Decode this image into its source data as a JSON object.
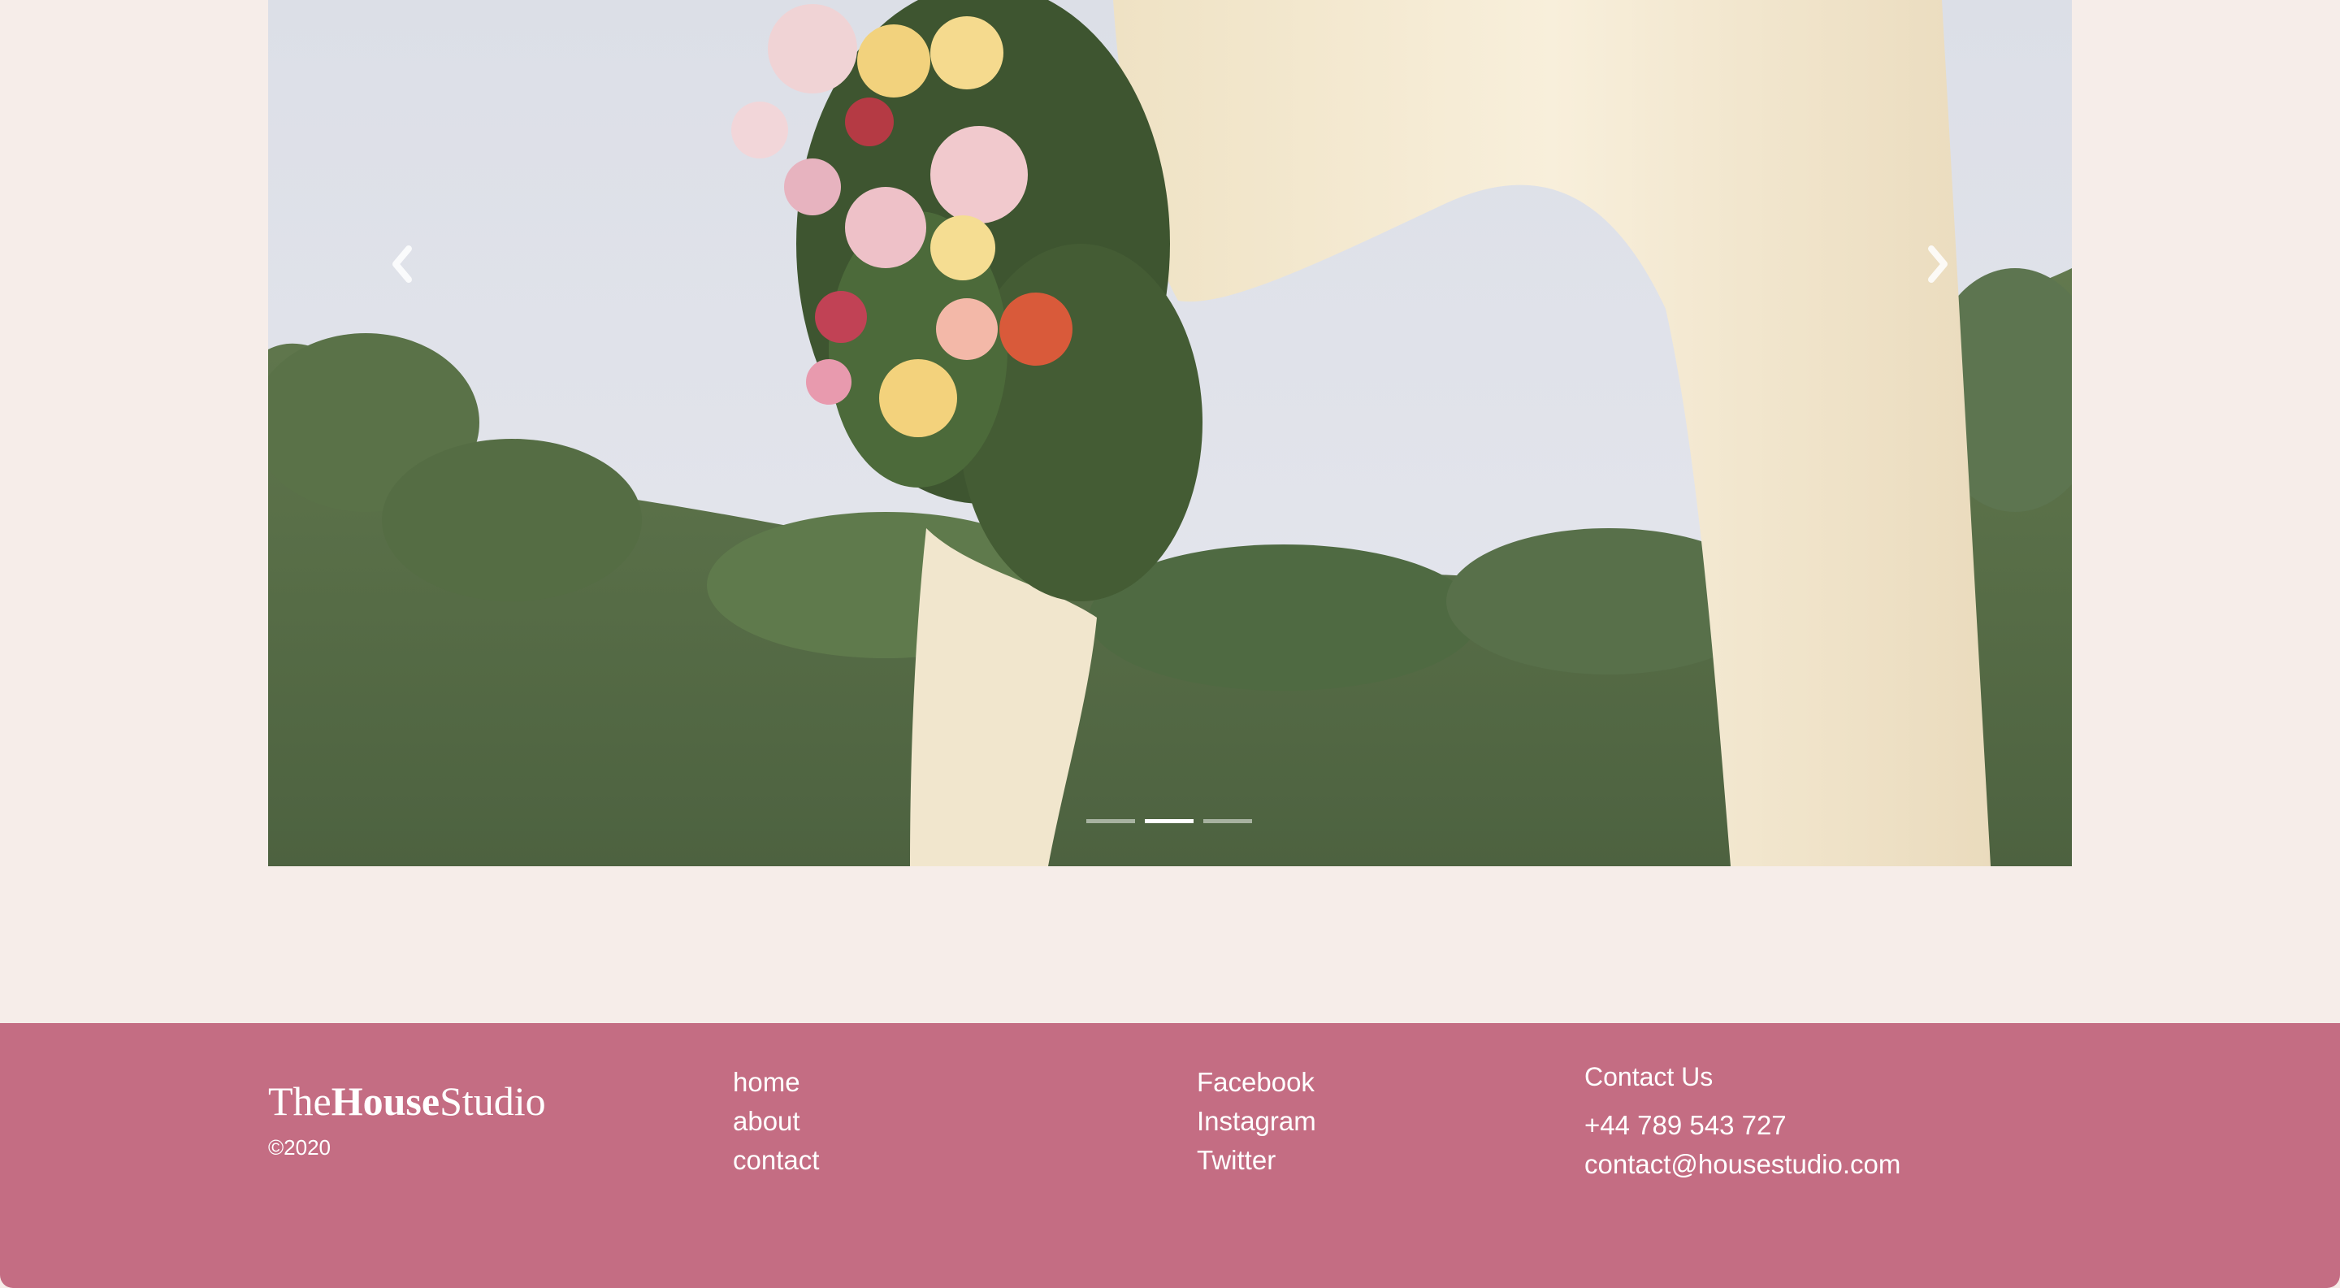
{
  "carousel": {
    "slide_alt": "Bridal bouquet of roses held against draped cream fabric over treetops",
    "prev_icon": "chevron-left-icon",
    "next_icon": "chevron-right-icon",
    "indicators": [
      {
        "active": false
      },
      {
        "active": true
      },
      {
        "active": false
      }
    ]
  },
  "footer": {
    "brand": {
      "prefix": "The",
      "bold": "House",
      "suffix": "Studio"
    },
    "copyright": "©2020",
    "nav_links": [
      "home",
      "about",
      "contact"
    ],
    "social_links": [
      "Facebook",
      "Instagram",
      "Twitter"
    ],
    "contact": {
      "heading": "Contact Us",
      "phone": "+44 789 543 727",
      "email": "contact@housestudio.com"
    }
  },
  "colors": {
    "page_bg": "#f6ede9",
    "footer_bg": "#c46d83",
    "footer_text": "#ffffff"
  }
}
